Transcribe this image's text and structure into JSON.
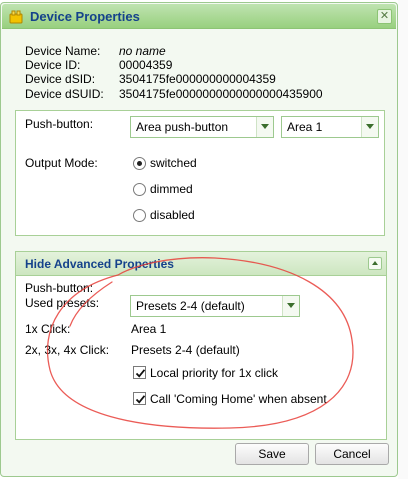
{
  "window": {
    "title": "Device Properties",
    "close_symbol": "✕"
  },
  "device_info": {
    "rows": [
      {
        "label": "Device Name:",
        "value": "no name"
      },
      {
        "label": "Device ID:",
        "value": "00004359"
      },
      {
        "label": "Device dSID:",
        "value": "3504175fe000000000004359"
      },
      {
        "label": "Device dSUID:",
        "value": "3504175fe0000000000000000435900"
      }
    ]
  },
  "push_button": {
    "label": "Push-button:",
    "type_select": "Area push-button",
    "area_select": "Area 1",
    "output_mode_label": "Output Mode:",
    "modes": [
      {
        "label": "switched",
        "checked": true
      },
      {
        "label": "dimmed",
        "checked": false
      },
      {
        "label": "disabled",
        "checked": false
      }
    ]
  },
  "advanced": {
    "header": "Hide Advanced Properties",
    "push_button_label": "Push-button:",
    "used_presets_label": "Used presets:",
    "used_presets_select": "Presets 2-4 (default)",
    "click1_label": "1x Click:",
    "click1_value": "Area 1",
    "clickN_label": "2x, 3x, 4x Click:",
    "clickN_value": "Presets 2-4 (default)",
    "local_priority_label": "Local priority for 1x click",
    "local_priority_checked": true,
    "coming_home_label": "Call 'Coming Home' when absent",
    "coming_home_checked": true
  },
  "footer": {
    "save_label": "Save",
    "cancel_label": "Cancel"
  },
  "colors": {
    "title_text": "#15428b",
    "window_border": "#9dc98f",
    "annotation_circle": "#e8403a"
  },
  "icons": {
    "app": "device-icon",
    "close": "close-icon",
    "collapse": "collapse-icon"
  }
}
